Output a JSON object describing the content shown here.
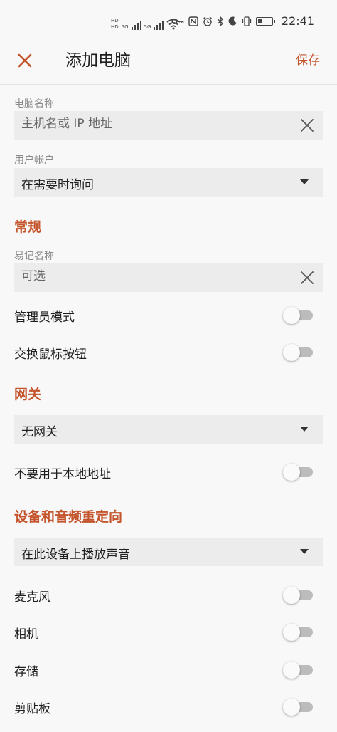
{
  "status_bar": {
    "net_left": "5G",
    "net_right": "5G",
    "wifi_label": "6",
    "time": "22:41"
  },
  "appbar": {
    "title": "添加电脑",
    "save_label": "保存"
  },
  "pc_name": {
    "label": "电脑名称",
    "placeholder": "主机名或 IP 地址",
    "value": ""
  },
  "user_account": {
    "label": "用户帐户",
    "selected": "在需要时询问"
  },
  "general": {
    "title": "常规",
    "friendly_name": {
      "label": "易记名称",
      "placeholder": "可选",
      "value": ""
    },
    "admin_mode": {
      "label": "管理员模式",
      "on": false
    },
    "swap_mouse": {
      "label": "交换鼠标按钮",
      "on": false
    }
  },
  "gateway": {
    "title": "网关",
    "selected": "无网关",
    "bypass_local": {
      "label": "不要用于本地地址",
      "on": false
    }
  },
  "redirection": {
    "title": "设备和音频重定向",
    "sound_selected": "在此设备上播放声音",
    "microphone": {
      "label": "麦克风",
      "on": false
    },
    "camera": {
      "label": "相机",
      "on": false
    },
    "storage": {
      "label": "存储",
      "on": false
    },
    "clipboard": {
      "label": "剪贴板",
      "on": false
    }
  },
  "colors": {
    "accent": "#c4542b",
    "background": "#f8f8f8",
    "field": "#ececec",
    "switch_off_track": "#bcbcbc"
  }
}
